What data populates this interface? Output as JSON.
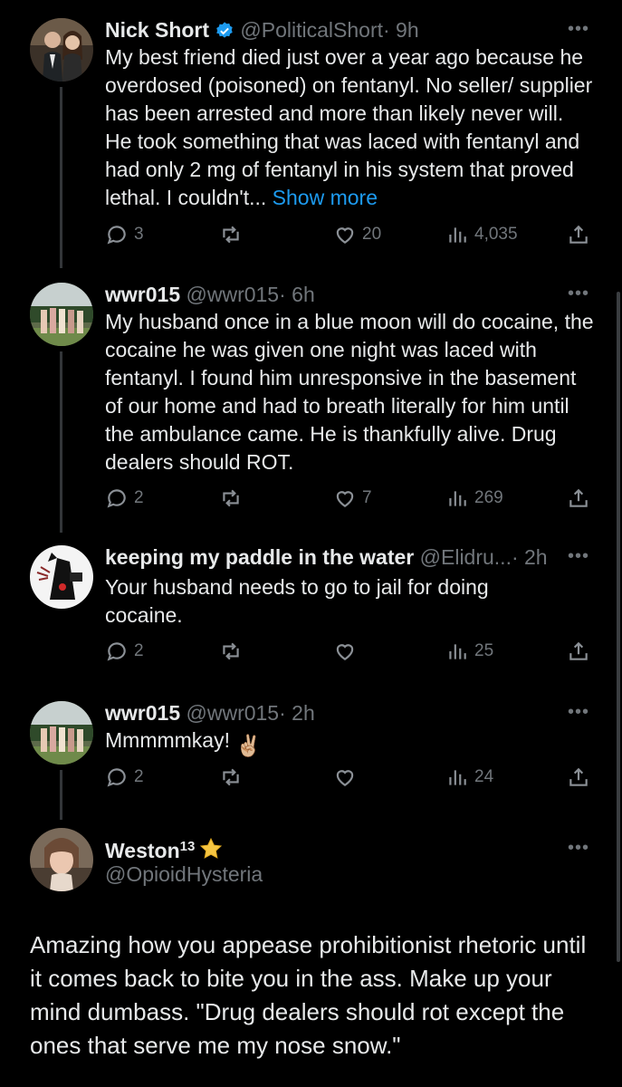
{
  "posts": [
    {
      "name": "Nick Short",
      "handle": "@PoliticalShort",
      "time": "· 9h",
      "verified": true,
      "text": "My best friend died just over a year ago because he overdosed (poisoned) on fentanyl. No seller/ supplier has been arrested and more than likely never will. He took something that was laced with fentanyl and had only 2 mg of fentanyl in his system that proved lethal. I couldn't...",
      "show_more": "Show more",
      "replies": "3",
      "reposts": "",
      "likes": "20",
      "views": "4,035"
    },
    {
      "name": "wwr015",
      "handle": "@wwr015",
      "time": "· 6h",
      "text": "My husband once in a blue moon will do cocaine, the cocaine he was given one night was laced with fentanyl. I found him unresponsive in the basement of our home and had to breath literally for him until the ambulance came. He is thankfully alive. Drug dealers should ROT.",
      "replies": "2",
      "reposts": "",
      "likes": "7",
      "views": "269"
    },
    {
      "name": "keeping my paddle in the water",
      "handle": "@Elidru...",
      "time": "· 2h",
      "text": "Your husband needs to go to jail for doing cocaine.",
      "replies": "2",
      "reposts": "",
      "likes": "",
      "views": "25"
    },
    {
      "name": "wwr015",
      "handle": "@wwr015",
      "time": "· 2h",
      "text": "Mmmmmkay!",
      "emoji": "✌🏼",
      "replies": "2",
      "reposts": "",
      "likes": "",
      "views": "24"
    }
  ],
  "main_post": {
    "name": "Weston",
    "name_sup": "13",
    "handle": "@OpioidHysteria",
    "text": "Amazing how you appease prohibitionist rhetoric until it comes back to bite you in the ass. Make up your mind dumbass. \"Drug dealers should rot except the ones that serve me my nose snow.\""
  },
  "colors": {
    "background": "#000000",
    "text": "#e7e9ea",
    "secondary": "#71767b",
    "link": "#1d9bf0",
    "verified": "#1d9bf0",
    "star": "#f5c542"
  },
  "icons": [
    "reply-icon",
    "repost-icon",
    "like-icon",
    "views-icon",
    "share-icon",
    "more-icon",
    "verified-icon",
    "star-icon"
  ]
}
